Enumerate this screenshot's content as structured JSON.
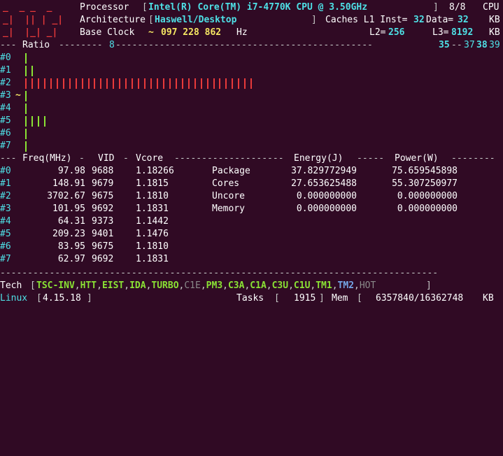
{
  "logo": [
    "_  _ _  _",
    "_|  || | _|",
    "_|  |_| _|"
  ],
  "processor": {
    "label": "Processor",
    "value": "Intel(R) Core(TM) i7-4770K CPU @ 3.50GHz",
    "threads": "8/8",
    "threads_label": "CPU"
  },
  "architecture": {
    "label": "Architecture",
    "value": "Haswell/Desktop",
    "caches_label": "Caches L1 Inst=",
    "l1_inst": "32",
    "data_label": "Data=",
    "l1_data": "32",
    "kb": "KB",
    "l2_label": "L2=",
    "l2": "256",
    "l3_label": "L3=",
    "l3": "8192",
    "kb2": "KB"
  },
  "base_clock": {
    "label": "Base Clock",
    "tilde": "~",
    "value": "097 228 862",
    "unit": "Hz"
  },
  "ratio": {
    "label": "Ratio",
    "marks": [
      "8",
      "35",
      "37",
      "38",
      "39"
    ],
    "cores": [
      {
        "id": "#0",
        "ratio": 1
      },
      {
        "id": "#1",
        "ratio": 2
      },
      {
        "id": "#2",
        "ratio": 37
      },
      {
        "id": "#3",
        "ratio": 1,
        "prefix": "~"
      },
      {
        "id": "#4",
        "ratio": 1
      },
      {
        "id": "#5",
        "ratio": 4
      },
      {
        "id": "#6",
        "ratio": 1
      },
      {
        "id": "#7",
        "ratio": 1
      }
    ]
  },
  "table": {
    "header": {
      "freq": "Freq(MHz)",
      "vid": "VID",
      "vcore": "Vcore",
      "energy": "Energy(J)",
      "power": "Power(W)"
    },
    "rows": [
      {
        "id": "#0",
        "freq": "97.98",
        "vid": "9688",
        "vcore": "1.18266"
      },
      {
        "id": "#1",
        "freq": "148.91",
        "vid": "9679",
        "vcore": "1.1815"
      },
      {
        "id": "#2",
        "freq": "3702.67",
        "vid": "9675",
        "vcore": "1.1810"
      },
      {
        "id": "#3",
        "freq": "101.95",
        "vid": "9692",
        "vcore": "1.1831"
      },
      {
        "id": "#4",
        "freq": "64.31",
        "vid": "9373",
        "vcore": "1.1442"
      },
      {
        "id": "#5",
        "freq": "209.23",
        "vid": "9401",
        "vcore": "1.1476"
      },
      {
        "id": "#6",
        "freq": "83.95",
        "vid": "9675",
        "vcore": "1.1810"
      },
      {
        "id": "#7",
        "freq": "62.97",
        "vid": "9692",
        "vcore": "1.1831"
      }
    ],
    "energy": [
      {
        "label": "Package",
        "energy": "37.829772949",
        "power": "75.659545898"
      },
      {
        "label": "Cores",
        "energy": "27.653625488",
        "power": "55.307250977"
      },
      {
        "label": "Uncore",
        "energy": "0.000000000",
        "power": "0.000000000"
      },
      {
        "label": "Memory",
        "energy": "0.000000000",
        "power": "0.000000000"
      }
    ]
  },
  "tech": {
    "label": "Tech",
    "flags": [
      {
        "name": "TSC-INV",
        "on": true
      },
      {
        "name": "HTT",
        "on": true
      },
      {
        "name": "EIST",
        "on": true
      },
      {
        "name": "IDA",
        "on": true
      },
      {
        "name": "TURBO",
        "on": true
      },
      {
        "name": "C1E",
        "on": false
      },
      {
        "name": "PM3",
        "on": true
      },
      {
        "name": "C3A",
        "on": true
      },
      {
        "name": "C1A",
        "on": true
      },
      {
        "name": "C3U",
        "on": true
      },
      {
        "name": "C1U",
        "on": true
      },
      {
        "name": "TM1",
        "on": true
      },
      {
        "name": "TM2",
        "on": "blue"
      },
      {
        "name": "HOT",
        "on": false
      }
    ]
  },
  "status": {
    "os": "Linux",
    "kernel": "4.15.18",
    "tasks_label": "Tasks",
    "tasks": "1915",
    "mem_label": "Mem",
    "mem": "6357840/16362748",
    "mem_unit": "KB"
  }
}
